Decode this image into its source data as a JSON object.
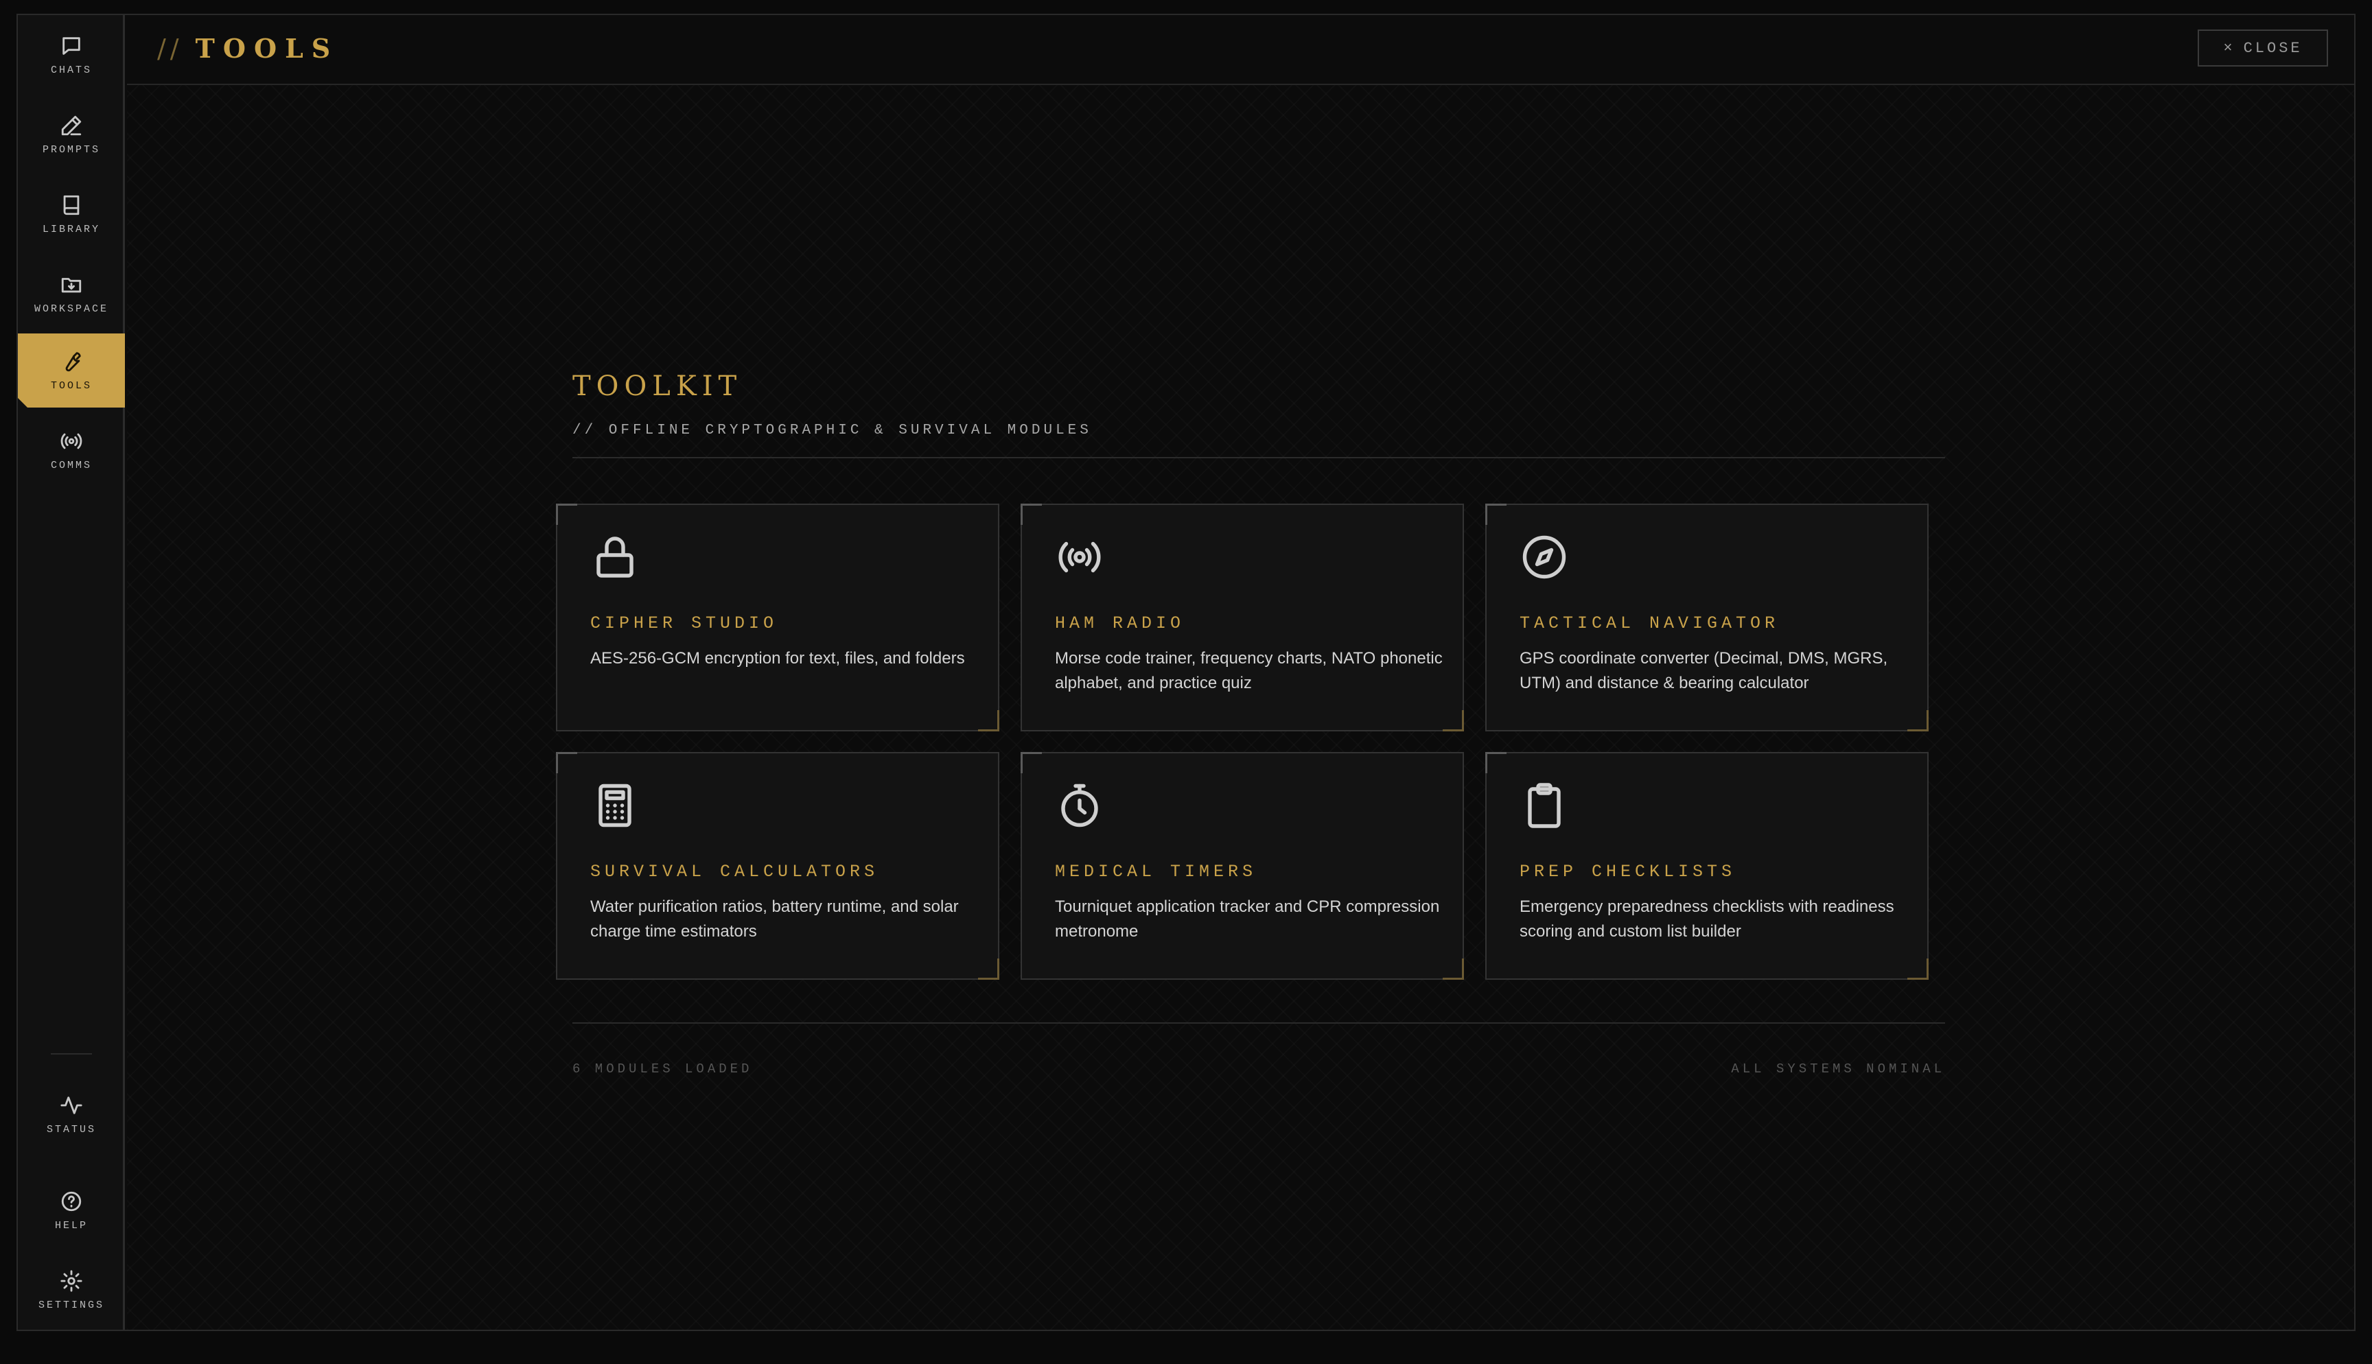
{
  "sidebar": {
    "top_items": [
      {
        "label": "CHATS",
        "icon": "chat-icon"
      },
      {
        "label": "PROMPTS",
        "icon": "pen-icon"
      },
      {
        "label": "LIBRARY",
        "icon": "book-icon"
      },
      {
        "label": "WORKSPACE",
        "icon": "folder-download-icon"
      },
      {
        "label": "TOOLS",
        "icon": "wrench-icon",
        "active": true
      },
      {
        "label": "COMMS",
        "icon": "broadcast-icon"
      }
    ],
    "bottom_items": [
      {
        "label": "STATUS",
        "icon": "activity-icon"
      },
      {
        "label": "HELP",
        "icon": "help-icon"
      },
      {
        "label": "SETTINGS",
        "icon": "gear-icon"
      }
    ]
  },
  "header": {
    "slashes": "//",
    "title": "TOOLS",
    "close_icon": "×",
    "close_label": "CLOSE"
  },
  "toolkit": {
    "title": "TOOLKIT",
    "subtitle": "// OFFLINE CRYPTOGRAPHIC & SURVIVAL MODULES"
  },
  "cards": [
    {
      "name": "CIPHER STUDIO",
      "icon": "lock-icon",
      "description": "AES-256-GCM encryption for text, files, and folders"
    },
    {
      "name": "HAM RADIO",
      "icon": "radio-icon",
      "description": "Morse code trainer, frequency charts, NATO phonetic alphabet, and practice quiz"
    },
    {
      "name": "TACTICAL NAVIGATOR",
      "icon": "compass-icon",
      "description": "GPS coordinate converter (Decimal, DMS, MGRS, UTM) and distance & bearing calculator"
    },
    {
      "name": "SURVIVAL CALCULATORS",
      "icon": "calculator-icon",
      "description": "Water purification ratios, battery runtime, and solar charge time estimators"
    },
    {
      "name": "MEDICAL TIMERS",
      "icon": "stopwatch-icon",
      "description": "Tourniquet application tracker and CPR compression metronome"
    },
    {
      "name": "PREP CHECKLISTS",
      "icon": "clipboard-icon",
      "description": "Emergency preparedness checklists with readiness scoring and custom list builder"
    }
  ],
  "footer": {
    "left": "6 MODULES LOADED",
    "right": "ALL SYSTEMS NOMINAL"
  },
  "colors": {
    "accent": "#c9a24a",
    "background": "#0b0b0b",
    "card": "#131313"
  }
}
